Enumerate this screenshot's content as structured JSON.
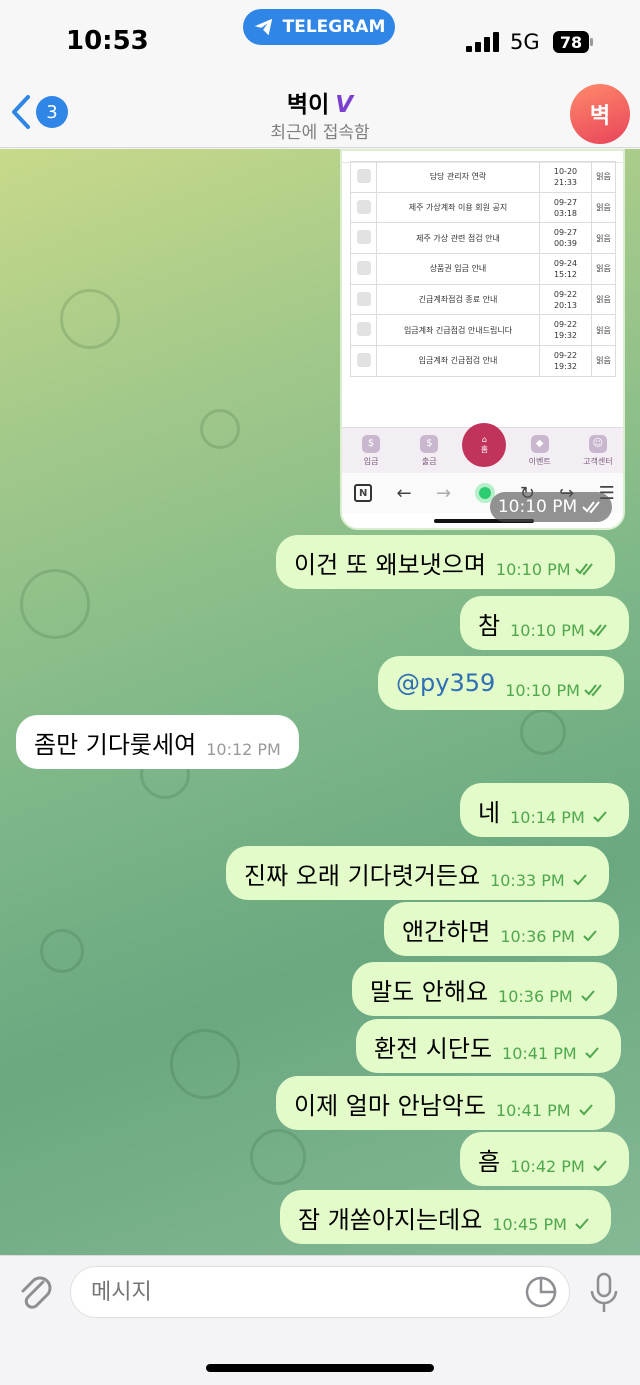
{
  "status": {
    "time": "10:53",
    "app_pill": "TELEGRAM",
    "network": "5G",
    "battery": "78"
  },
  "header": {
    "back_count": "3",
    "title": "벽이",
    "title_badge": "V",
    "subtitle": "최근에 접속함",
    "avatar_initial": "벽"
  },
  "image_message": {
    "table_rows": [
      {
        "title": "담당 관리자 연락",
        "date": "10-20",
        "time": "21:33",
        "status": "읽음"
      },
      {
        "title": "제주 가상계좌 이용 회원 공지",
        "date": "09-27",
        "time": "03:18",
        "status": "읽음"
      },
      {
        "title": "제주 가상 관련 점검 안내",
        "date": "09-27",
        "time": "00:39",
        "status": "읽음"
      },
      {
        "title": "상품권 입금 안내",
        "date": "09-24",
        "time": "15:12",
        "status": "읽음"
      },
      {
        "title": "긴급계좌점검 종료 안내",
        "date": "09-22",
        "time": "20:13",
        "status": "읽음"
      },
      {
        "title": "입금계좌 긴급점검 안내드립니다",
        "date": "09-22",
        "time": "19:32",
        "status": "읽음"
      },
      {
        "title": "입금계좌 긴급점검 안내",
        "date": "09-22",
        "time": "19:32",
        "status": "읽음"
      }
    ],
    "nav": [
      "입금",
      "출금",
      "홈",
      "이벤트",
      "고객센터"
    ],
    "time": "10:10 PM"
  },
  "messages": [
    {
      "dir": "out",
      "text": "이건 또 왜보냇으며",
      "time": "10:10 PM",
      "read": true
    },
    {
      "dir": "out",
      "text": "참",
      "time": "10:10 PM",
      "read": true
    },
    {
      "dir": "out",
      "text": "@py359",
      "time": "10:10 PM",
      "read": true,
      "link": true
    },
    {
      "dir": "in",
      "text": "좀만 기다룿세여",
      "time": "10:12 PM"
    },
    {
      "dir": "out",
      "text": "네",
      "time": "10:14 PM",
      "read": false
    },
    {
      "dir": "out",
      "text": "진짜 오래 기다렷거든요",
      "time": "10:33 PM",
      "read": false
    },
    {
      "dir": "out",
      "text": "앤간하면",
      "time": "10:36 PM",
      "read": false
    },
    {
      "dir": "out",
      "text": "말도 안해요",
      "time": "10:36 PM",
      "read": false
    },
    {
      "dir": "out",
      "text": "환전 시단도",
      "time": "10:41 PM",
      "read": false
    },
    {
      "dir": "out",
      "text": "이제 얼마 안남악도",
      "time": "10:41 PM",
      "read": false
    },
    {
      "dir": "out",
      "text": "흠",
      "time": "10:42 PM",
      "read": false
    },
    {
      "dir": "out",
      "text": "잠 개쏟아지는데요",
      "time": "10:45 PM",
      "read": false
    }
  ],
  "input": {
    "placeholder": "메시지"
  },
  "colors": {
    "accent": "#2f86e6",
    "outgoing_bubble": "#e3fac9",
    "check": "#4fa84e"
  }
}
